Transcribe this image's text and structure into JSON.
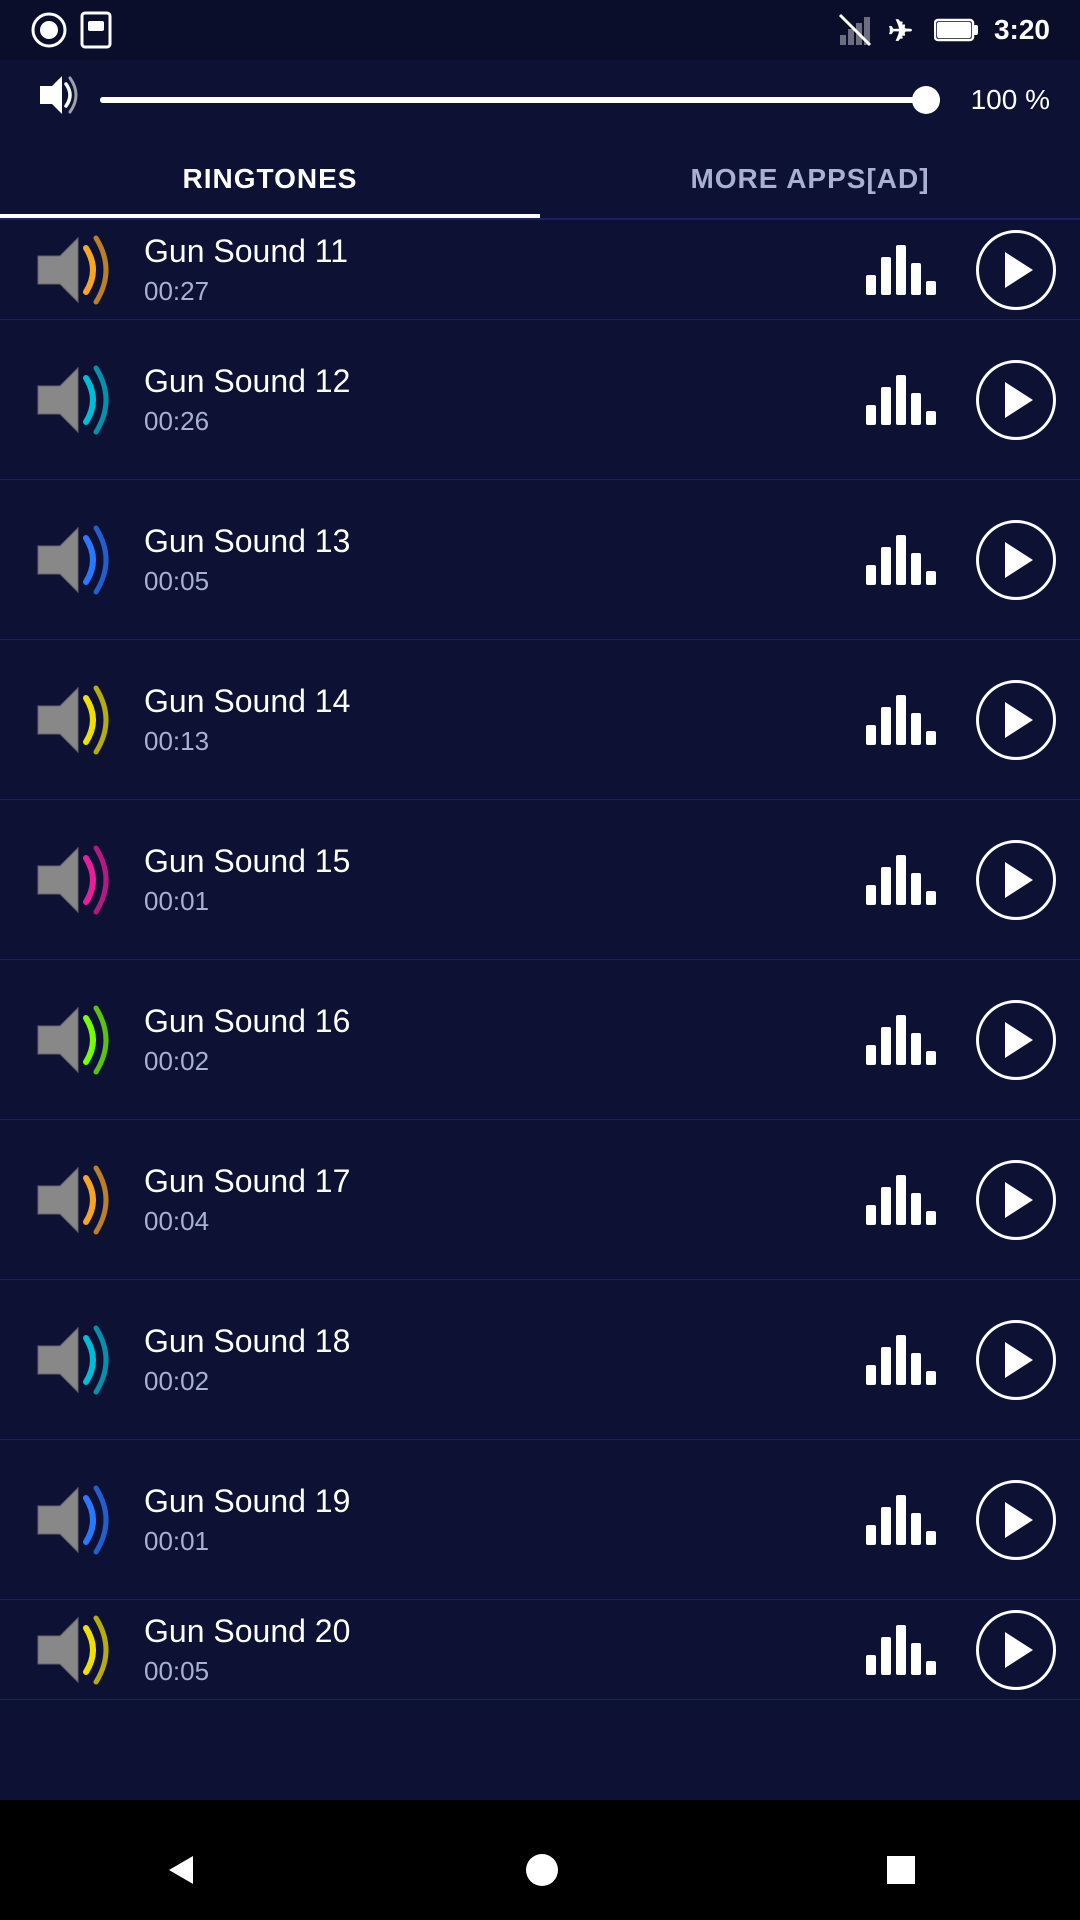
{
  "statusBar": {
    "time": "3:20",
    "icons": [
      "record",
      "sim",
      "no-signal",
      "airplane",
      "battery"
    ]
  },
  "volume": {
    "icon": "🔊",
    "percent": "100 %",
    "value": 100
  },
  "tabs": [
    {
      "id": "ringtones",
      "label": "RINGTONES",
      "active": true
    },
    {
      "id": "more-apps",
      "label": "MORE APPS[AD]",
      "active": false
    }
  ],
  "sounds": [
    {
      "id": 11,
      "name": "Gun Sound 11",
      "duration": "00:27",
      "waveColor": "orange",
      "partial": true
    },
    {
      "id": 12,
      "name": "Gun Sound 12",
      "duration": "00:26",
      "waveColor": "cyan"
    },
    {
      "id": 13,
      "name": "Gun Sound 13",
      "duration": "00:05",
      "waveColor": "blue"
    },
    {
      "id": 14,
      "name": "Gun Sound 14",
      "duration": "00:13",
      "waveColor": "yellow"
    },
    {
      "id": 15,
      "name": "Gun Sound 15",
      "duration": "00:01",
      "waveColor": "magenta"
    },
    {
      "id": 16,
      "name": "Gun Sound 16",
      "duration": "00:02",
      "waveColor": "lime"
    },
    {
      "id": 17,
      "name": "Gun Sound 17",
      "duration": "00:04",
      "waveColor": "orange"
    },
    {
      "id": 18,
      "name": "Gun Sound 18",
      "duration": "00:02",
      "waveColor": "cyan"
    },
    {
      "id": 19,
      "name": "Gun Sound 19",
      "duration": "00:01",
      "waveColor": "blue"
    },
    {
      "id": 20,
      "name": "Gun Sound 20",
      "duration": "00:05",
      "waveColor": "yellow",
      "partial": true
    }
  ],
  "navbar": {
    "back": "◀",
    "home": "●",
    "recent": "■"
  }
}
